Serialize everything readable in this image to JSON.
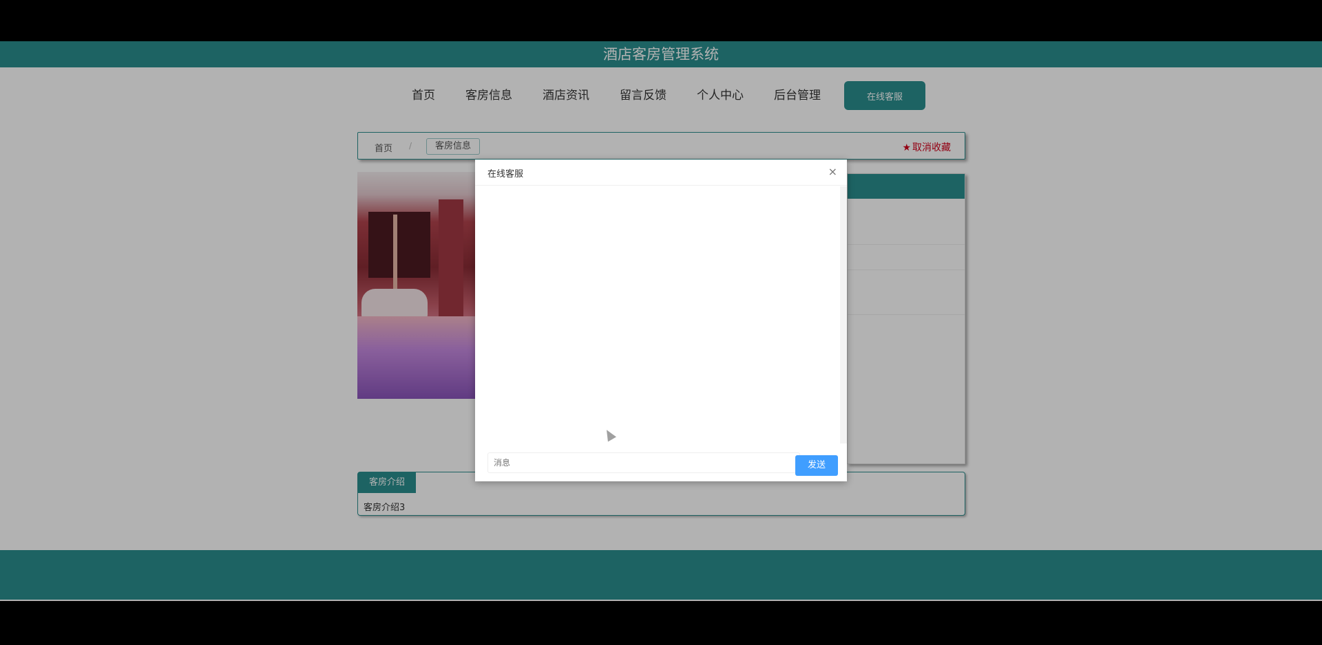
{
  "site": {
    "title": "酒店客房管理系统"
  },
  "nav": {
    "items": [
      "首页",
      "客房信息",
      "酒店资讯",
      "留言反馈",
      "个人中心",
      "后台管理"
    ],
    "contact_label": "在线客服"
  },
  "breadcrumb": {
    "home": "首页",
    "separator": "/",
    "current": "客房信息"
  },
  "favorite": {
    "label": "取消收藏"
  },
  "intro": {
    "tab": "客房介绍",
    "text": "客房介绍3"
  },
  "dialog": {
    "title": "在线客服",
    "close": "×",
    "input_placeholder": "消息",
    "send_label": "发送"
  },
  "colors": {
    "brand": "#2a8f8f",
    "accent_button": "#409eff",
    "favorite": "#d3001b"
  }
}
